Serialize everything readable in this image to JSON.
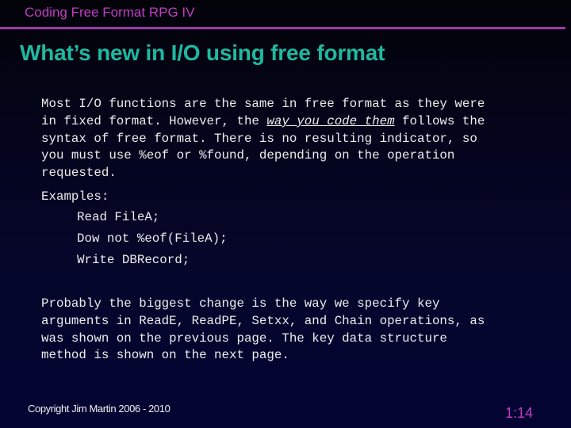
{
  "header": {
    "title": "Coding Free Format RPG IV"
  },
  "slide": {
    "title": "What’s new in I/O using free format",
    "paragraph1": {
      "line1": "Most I/O functions are the same in free format as they were",
      "line2_before": "in fixed format. However, the ",
      "line2_emphasis": "way you code them",
      "line2_after": " follows the",
      "line3": "syntax of free format. There is no resulting indicator, so",
      "line4": "you must use %eof or %found, depending on the operation",
      "line5": "requested."
    },
    "examples_label": "Examples:",
    "code_examples": [
      "Read FileA;",
      "Dow not %eof(FileA);",
      "Write DBRecord;"
    ],
    "paragraph2": {
      "line1": "Probably the biggest change is the way we specify key",
      "line2": "arguments in ReadE, ReadPE, Setxx, and Chain operations, as",
      "line3": "was shown on the previous page. The key data structure",
      "line4": "method is shown on the next page."
    }
  },
  "footer": {
    "copyright": "Copyright Jim Martin 2006 - 2010",
    "page_number": "1:14"
  },
  "colors": {
    "header_accent": "#c23cc4",
    "rule": "#9a3aa8",
    "title": "#1fb8a0",
    "body_text": "#ececec",
    "background_bottom": "#040433"
  }
}
